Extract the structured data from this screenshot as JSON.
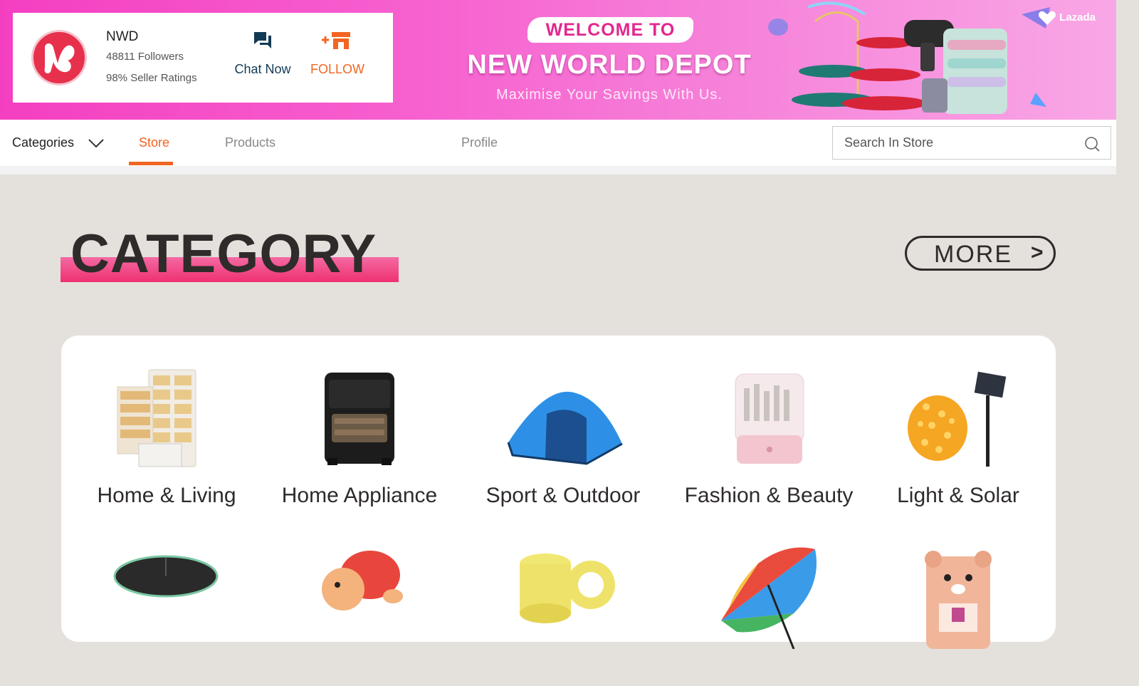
{
  "store": {
    "name": "NWD",
    "followers": "48811 Followers",
    "ratings": "98% Seller Ratings",
    "chat_label": "Chat Now",
    "follow_label": "FOLLOW"
  },
  "banner": {
    "welcome": "WELCOME TO",
    "title": "NEW WORLD DEPOT",
    "subtitle": "Maximise Your Savings With Us.",
    "brand": "Lazada"
  },
  "nav": {
    "categories": "Categories",
    "store": "Store",
    "products": "Products",
    "profile": "Profile",
    "active_tab": "Store"
  },
  "search": {
    "placeholder": "Search In Store"
  },
  "section": {
    "heading": "CATEGORY",
    "more_label": "MORE",
    "more_arrow": ">"
  },
  "categories": [
    {
      "label": "Home & Living",
      "icon": "shoe-cabinet-icon"
    },
    {
      "label": "Home Appliance",
      "icon": "air-fryer-icon"
    },
    {
      "label": "Sport & Outdoor",
      "icon": "tent-icon"
    },
    {
      "label": "Fashion & Beauty",
      "icon": "cosmetic-organizer-icon"
    },
    {
      "label": "Light & Solar",
      "icon": "solar-light-icon"
    }
  ],
  "categories_row2": [
    {
      "icon": "wireless-mouse-icon"
    },
    {
      "icon": "bath-toy-turtle-icon"
    },
    {
      "icon": "packing-tape-icon"
    },
    {
      "icon": "rainbow-umbrella-icon"
    },
    {
      "icon": "bear-gift-bag-icon"
    }
  ],
  "colors": {
    "accent": "#f26522",
    "banner_pink": "#f43fc1",
    "heading_bar": "#ef3071",
    "logo_red": "#e7304c"
  }
}
